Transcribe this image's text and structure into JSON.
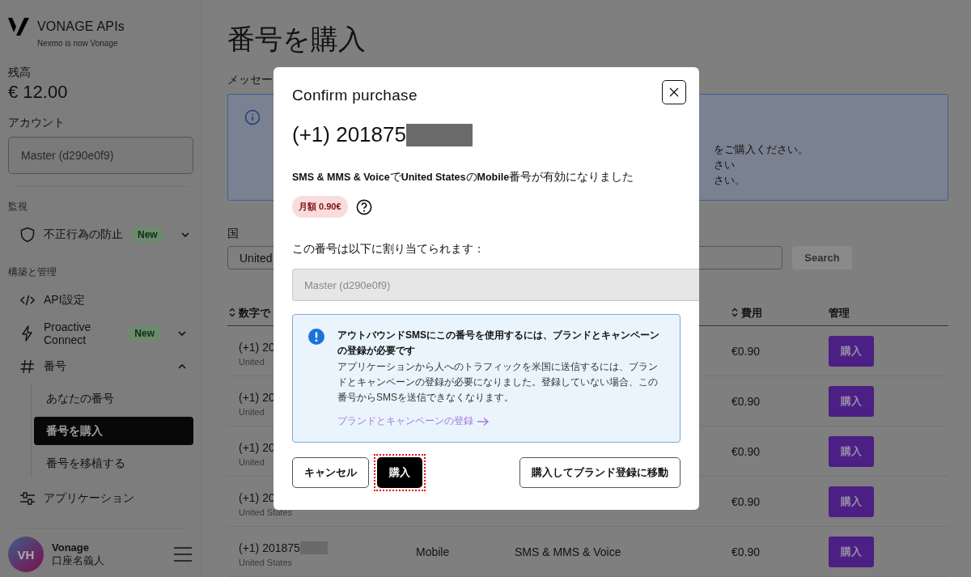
{
  "sidebar": {
    "brand": "VONAGE APIs",
    "tagline": "Nexmo is now Vonage",
    "balance_label": "残高",
    "balance": "€ 12.00",
    "account_label": "アカウント",
    "account_value": "Master (d290e0f9)",
    "sections": [
      {
        "heading": "監視",
        "items": [
          {
            "kind": "shield",
            "label": "不正行為の防止",
            "badge": "New",
            "expanded": false
          }
        ]
      },
      {
        "heading": "構築と管理",
        "items": [
          {
            "kind": "code",
            "label": "API設定"
          },
          {
            "kind": "bolt",
            "label": "Proactive Connect",
            "badge": "New",
            "expanded": false
          },
          {
            "kind": "hash",
            "label": "番号",
            "expanded": true,
            "children": [
              {
                "label": "あなたの番号",
                "selected": false
              },
              {
                "label": "番号を購入",
                "selected": true
              },
              {
                "label": "番号を移植する",
                "selected": false
              }
            ]
          },
          {
            "kind": "app",
            "label": "アプリケーション"
          }
        ]
      }
    ],
    "user": {
      "initials": "VH",
      "name": "Vonage",
      "subtitle": "口座名義人"
    }
  },
  "main": {
    "title": "番号を購入",
    "message_label": "メッセー",
    "notice_lines": [
      "をご購入ください。",
      "さい",
      "さい。"
    ],
    "country_label": "国",
    "country_value": "United",
    "search_button": "Search",
    "table": {
      "header_number": "数字で",
      "header_cost": "費用",
      "header_manage": "管理",
      "rows": [
        {
          "number": "(+1) 20",
          "country": "United",
          "cost": "€0.90",
          "button": "購入"
        },
        {
          "number": "(+1) 20",
          "country": "United",
          "cost": "€0.90",
          "button": "購入"
        },
        {
          "number": "(+1) 20",
          "country": "United",
          "cost": "€0.90",
          "button": "購入"
        },
        {
          "number": "(+1) 20",
          "country": "United States",
          "cost": "€0.90",
          "button": "購入"
        },
        {
          "number": "(+1) 201875",
          "country": "United States",
          "type": "Mobile",
          "features": "SMS & MMS & Voice",
          "cost": "€0.90",
          "button": "購入"
        }
      ]
    }
  },
  "modal": {
    "title": "Confirm purchase",
    "number": "(+1) 201875",
    "description": "**SMS & MMS & Voice**で**United States**の**Mobile**番号が有効になりました",
    "price_badge": "月額 0.90€",
    "assign_label": "この番号は以下に割り当てられます：",
    "assign_value": "Master (d290e0f9)",
    "alert": {
      "title": "アウトバウンドSMSにこの番号を使用するには、ブランドとキャンペーンの登録が必要です",
      "body": "アプリケーションから人へのトラフィックを米国に送信するには、ブランドとキャンペーンの登録が必要になりました。登録していない場合、この番号からSMSを送信できなくなります。",
      "link": "ブランドとキャンペーンの登録"
    },
    "buttons": [
      {
        "kind": "outline",
        "label": "キャンセル",
        "highlighted": false
      },
      {
        "kind": "primary",
        "label": "購入",
        "highlighted": true
      },
      {
        "kind": "outline",
        "label": "購入してブランド登録に移動",
        "highlighted": false
      }
    ]
  }
}
